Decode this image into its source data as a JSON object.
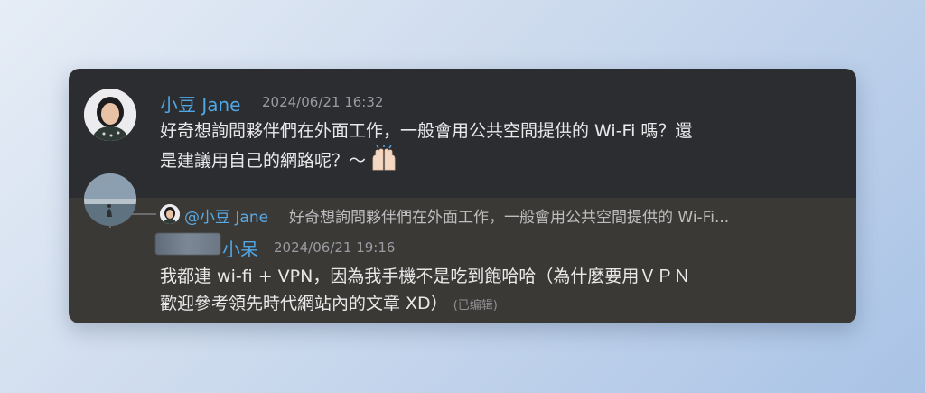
{
  "message_1": {
    "author": "小豆 Jane",
    "timestamp": "2024/06/21 16:32",
    "line_1": "好奇想詢問夥伴們在外面工作，一般會用公共空間提供的 Wi-Fi 嗎？還",
    "line_2": "是建議用自己的網路呢？～",
    "emoji": "raising-hands-emoji",
    "name_color": "#4fa7e6"
  },
  "reply_preview": {
    "mention": "@小豆 Jane",
    "text": "好奇想詢問夥伴們在外面工作，一般會用公共空間提供的 Wi-Fi..."
  },
  "message_2": {
    "author": "小呆",
    "timestamp": "2024/06/21 19:16",
    "line_1": "我都連 wi-fi + VPN，因為我手機不是吃到飽哈哈（為什麼要用ＶＰＮ",
    "line_2": "歡迎參考領先時代網站內的文章 XD）",
    "edited_label": "(已编辑)",
    "name_color": "#4fa7e6"
  },
  "colors": {
    "background_top": "#2c2d31",
    "background_bottom": "#3b3936",
    "mention": "#5aa9e3"
  }
}
